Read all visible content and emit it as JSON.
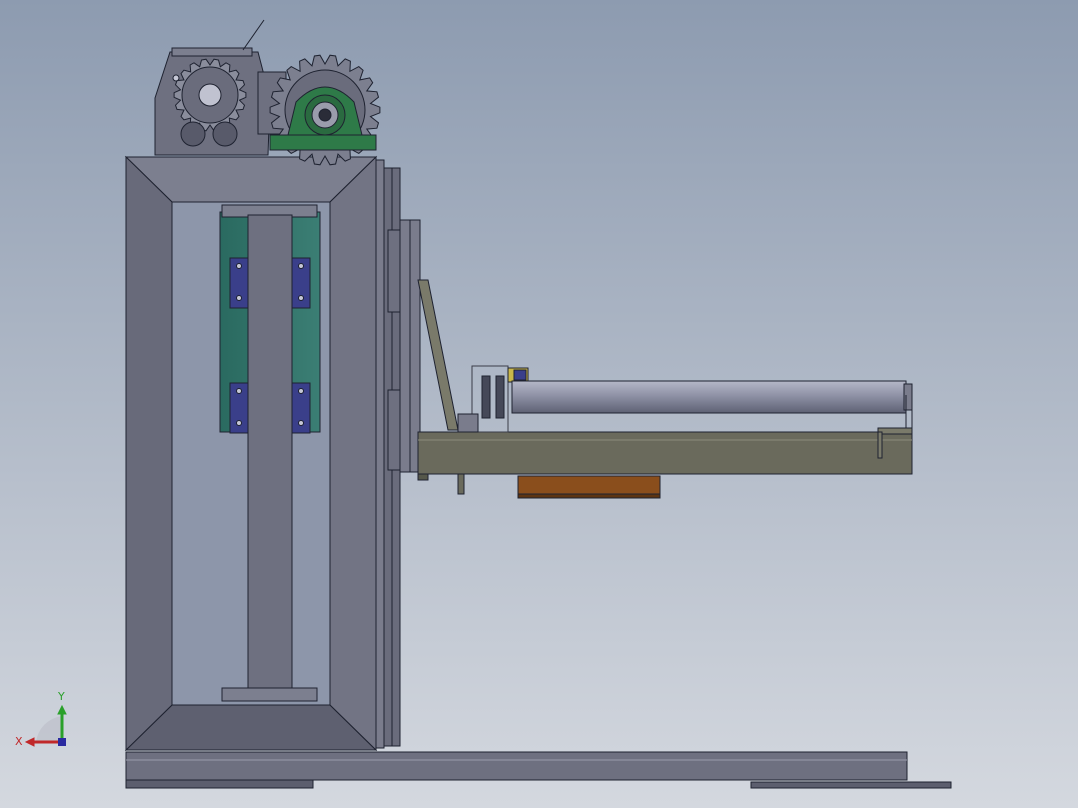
{
  "viewport": {
    "background_top": "#8d9bb0",
    "background_bottom": "#d4d8df"
  },
  "colors": {
    "steel": "#6e7080",
    "steel_light": "#8a8d9c",
    "steel_dark": "#55576a",
    "edge": "#1e2230",
    "slide_green": "#2e6e66",
    "bearing_blue": "#3a3f8a",
    "pillow_block_green": "#2e7a48",
    "arm_olive": "#6a6a5c",
    "roller_grey": "#8f92a6",
    "pad_brown": "#8a4e1c",
    "sensor_yellow": "#c9b64a"
  },
  "triad": {
    "x_label": "X",
    "y_label": "Y",
    "x_color": "#c0282a",
    "y_color": "#2aa02a",
    "z_color": "#2a2aa0"
  },
  "model": {
    "components": [
      "gear-motor",
      "drive-sprocket",
      "pillow-block-bearing",
      "frame",
      "vertical-column",
      "linear-slides",
      "carriage-plate",
      "cantilever-arm",
      "roller",
      "chain-sprockets",
      "base-rail"
    ]
  }
}
